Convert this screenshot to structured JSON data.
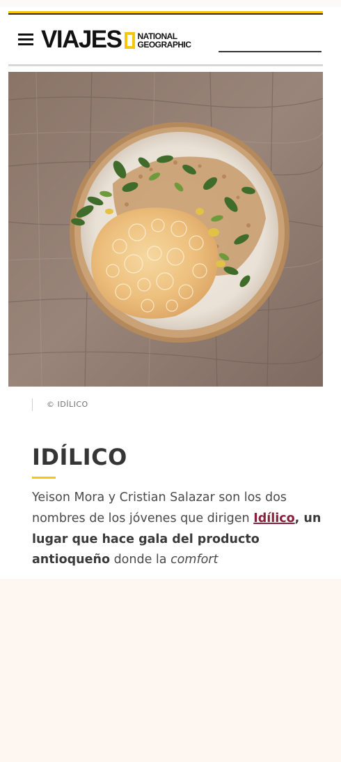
{
  "header": {
    "menu_icon": "hamburger-menu-icon",
    "logo_word": "VIAJES",
    "logo_sub_line1": "NATIONAL",
    "logo_sub_line2": "GEOGRAPHIC",
    "accent_yellow": "#f2c70d"
  },
  "hero_image": {
    "alt": "Plato de Idílico"
  },
  "article": {
    "photo_credit": "© IDÍLICO",
    "title": "IDÍLICO",
    "paragraph": {
      "part1": "Yeison Mora y Cristian Salazar son los dos nombres de los jóvenes que dirigen ",
      "link_text": "Idílico",
      "part2": ", un lugar que hace gala del producto antioqueño",
      "part3": " donde la ",
      "part4": "comfort"
    },
    "link_color": "#8a1f3c"
  }
}
